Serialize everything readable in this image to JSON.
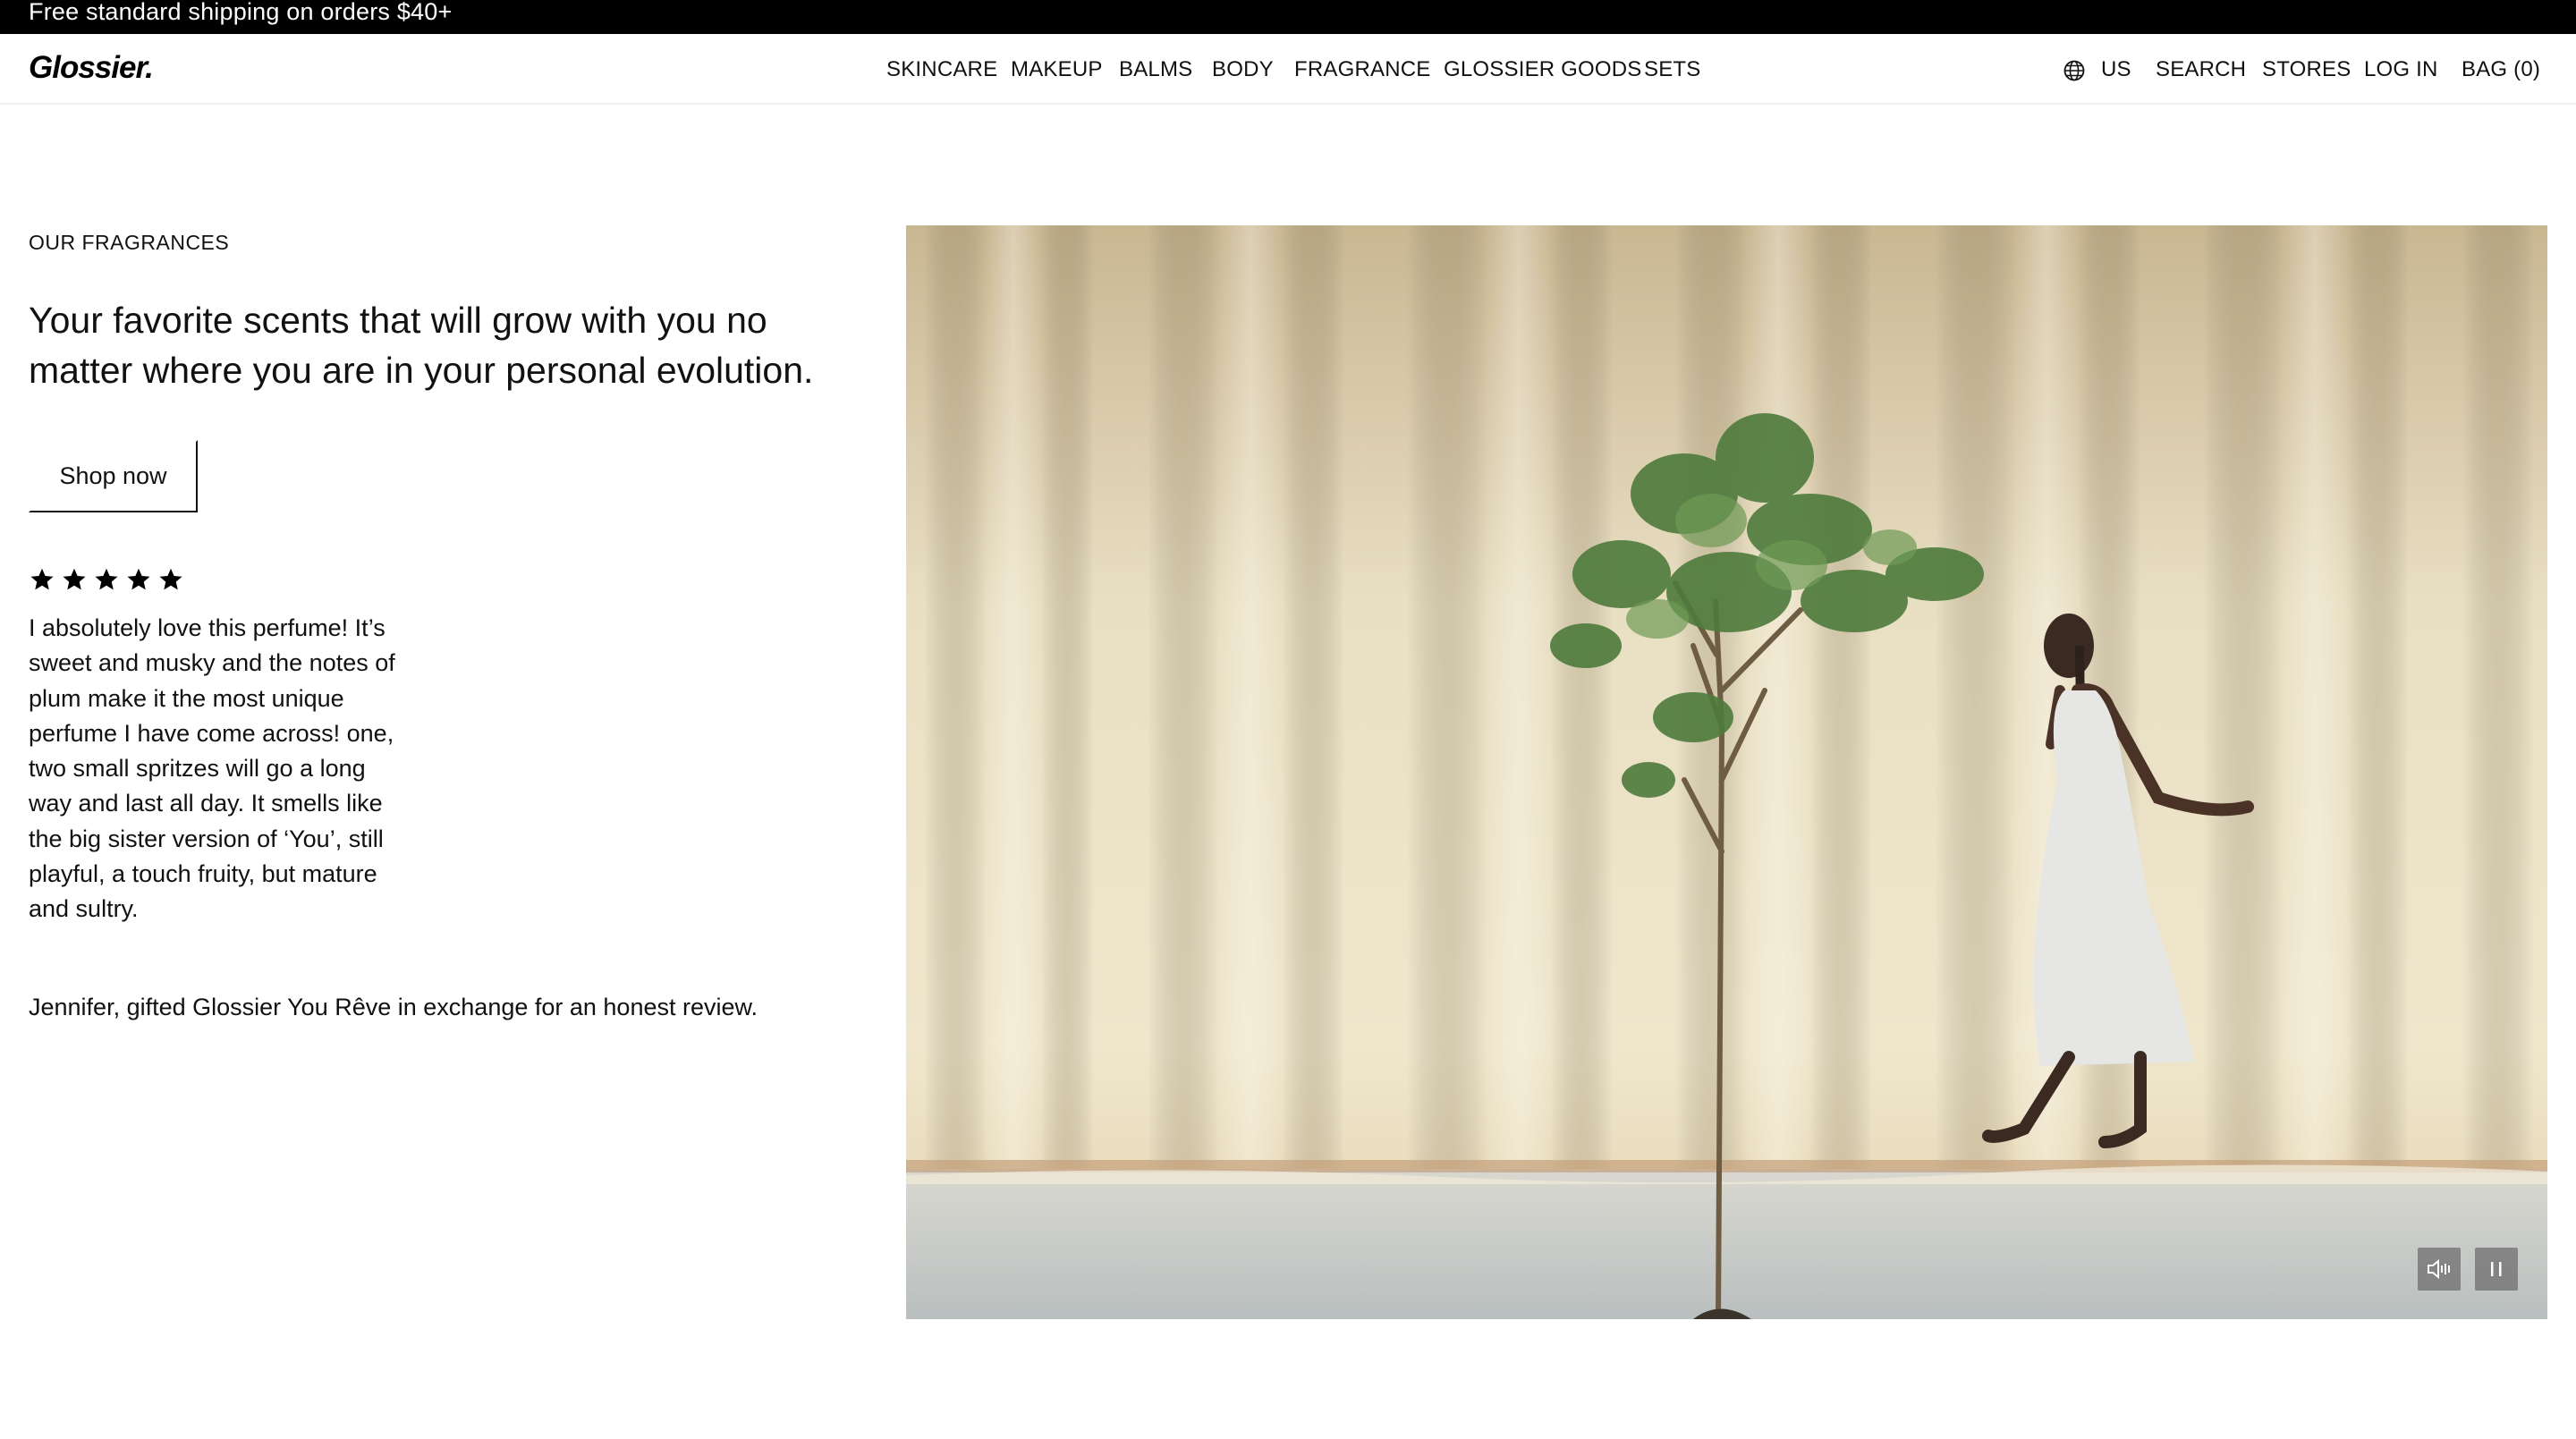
{
  "announcement": {
    "text": "Free standard shipping on orders $40+"
  },
  "header": {
    "logo": "Glossier.",
    "nav": [
      {
        "label": "SKINCARE"
      },
      {
        "label": "MAKEUP"
      },
      {
        "label": "BALMS"
      },
      {
        "label": "BODY"
      },
      {
        "label": "FRAGRANCE"
      },
      {
        "label": "GLOSSIER GOODS"
      },
      {
        "label": "SETS"
      }
    ],
    "utility": {
      "region_icon": "globe-icon",
      "region": "US",
      "search": "SEARCH",
      "stores": "STORES",
      "login": "LOG IN",
      "bag": "BAG (0)"
    }
  },
  "hero": {
    "eyebrow": "OUR FRAGRANCES",
    "headline": "Your favorite scents that will grow with you no matter where you are in your personal evolution.",
    "cta": "Shop now",
    "rating": 5,
    "review": "I absolutely love this perfume! It’s sweet and musky and the notes of plum make it the most unique perfume I have come across! one, two small spritzes will go a long way and last all day. It smells like the big sister version of ‘You’, still playful, a touch fruity, but mature and sultry.",
    "review_attribution": "Jennifer, gifted Glossier You Rêve in exchange for an honest review."
  },
  "media": {
    "controls": {
      "mute_icon": "volume-icon",
      "pause_icon": "pause-icon"
    }
  },
  "colors": {
    "announcement_bg": "#000000",
    "text": "#111111",
    "curtain": "#e7dcc0"
  }
}
